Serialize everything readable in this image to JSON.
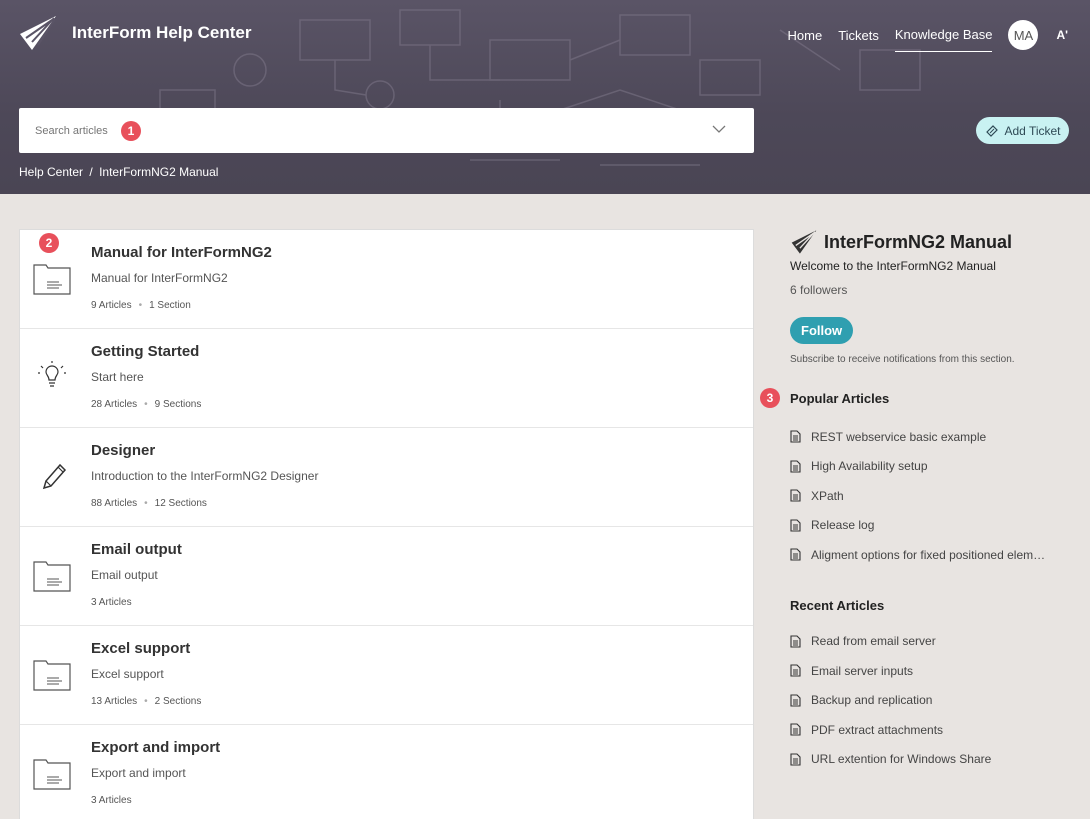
{
  "header": {
    "brand_title": "InterForm Help Center",
    "nav": [
      "Home",
      "Tickets",
      "Knowledge Base"
    ],
    "avatar_initials": "MA",
    "font_toggle": "A'",
    "add_ticket_label": "Add Ticket"
  },
  "search": {
    "placeholder": "Search articles",
    "badge": "1"
  },
  "breadcrumb": {
    "root": "Help Center",
    "separator": "/",
    "current": "InterFormNG2 Manual"
  },
  "list_badge": "2",
  "items": [
    {
      "title": "Manual for InterFormNG2",
      "desc": "Manual for InterFormNG2",
      "articles": "9 Articles",
      "sections": "1 Section",
      "icon": "folder-icon"
    },
    {
      "title": "Getting Started",
      "desc": "Start here",
      "articles": "28 Articles",
      "sections": "9 Sections",
      "icon": "lightbulb-icon"
    },
    {
      "title": "Designer",
      "desc": "Introduction to the InterFormNG2 Designer",
      "articles": "88 Articles",
      "sections": "12 Sections",
      "icon": "pencil-icon"
    },
    {
      "title": "Email output",
      "desc": "Email output",
      "articles": "3 Articles",
      "sections": "",
      "icon": "folder-icon"
    },
    {
      "title": "Excel support",
      "desc": "Excel support",
      "articles": "13 Articles",
      "sections": "2 Sections",
      "icon": "folder-icon"
    },
    {
      "title": "Export and import",
      "desc": "Export and import",
      "articles": "3 Articles",
      "sections": "",
      "icon": "folder-icon"
    }
  ],
  "sidebar": {
    "title": "InterFormNG2 Manual",
    "subtitle": "Welcome to the InterFormNG2 Manual",
    "followers": "6 followers",
    "follow_label": "Follow",
    "note": "Subscribe to receive notifications from this section.",
    "popular_heading": "Popular Articles",
    "popular_badge": "3",
    "popular": [
      "REST webservice basic example",
      "High Availability setup",
      "XPath",
      "Release log",
      "Aligment options for fixed positioned elements"
    ],
    "recent_heading": "Recent Articles",
    "recent": [
      "Read from email server",
      "Email server inputs",
      "Backup and replication",
      "PDF extract attachments",
      "URL extention for Windows Share"
    ]
  },
  "colors": {
    "accent": "#2f9fb0",
    "badge": "#e8505b",
    "add_ticket_bg": "#c9f2f2"
  }
}
